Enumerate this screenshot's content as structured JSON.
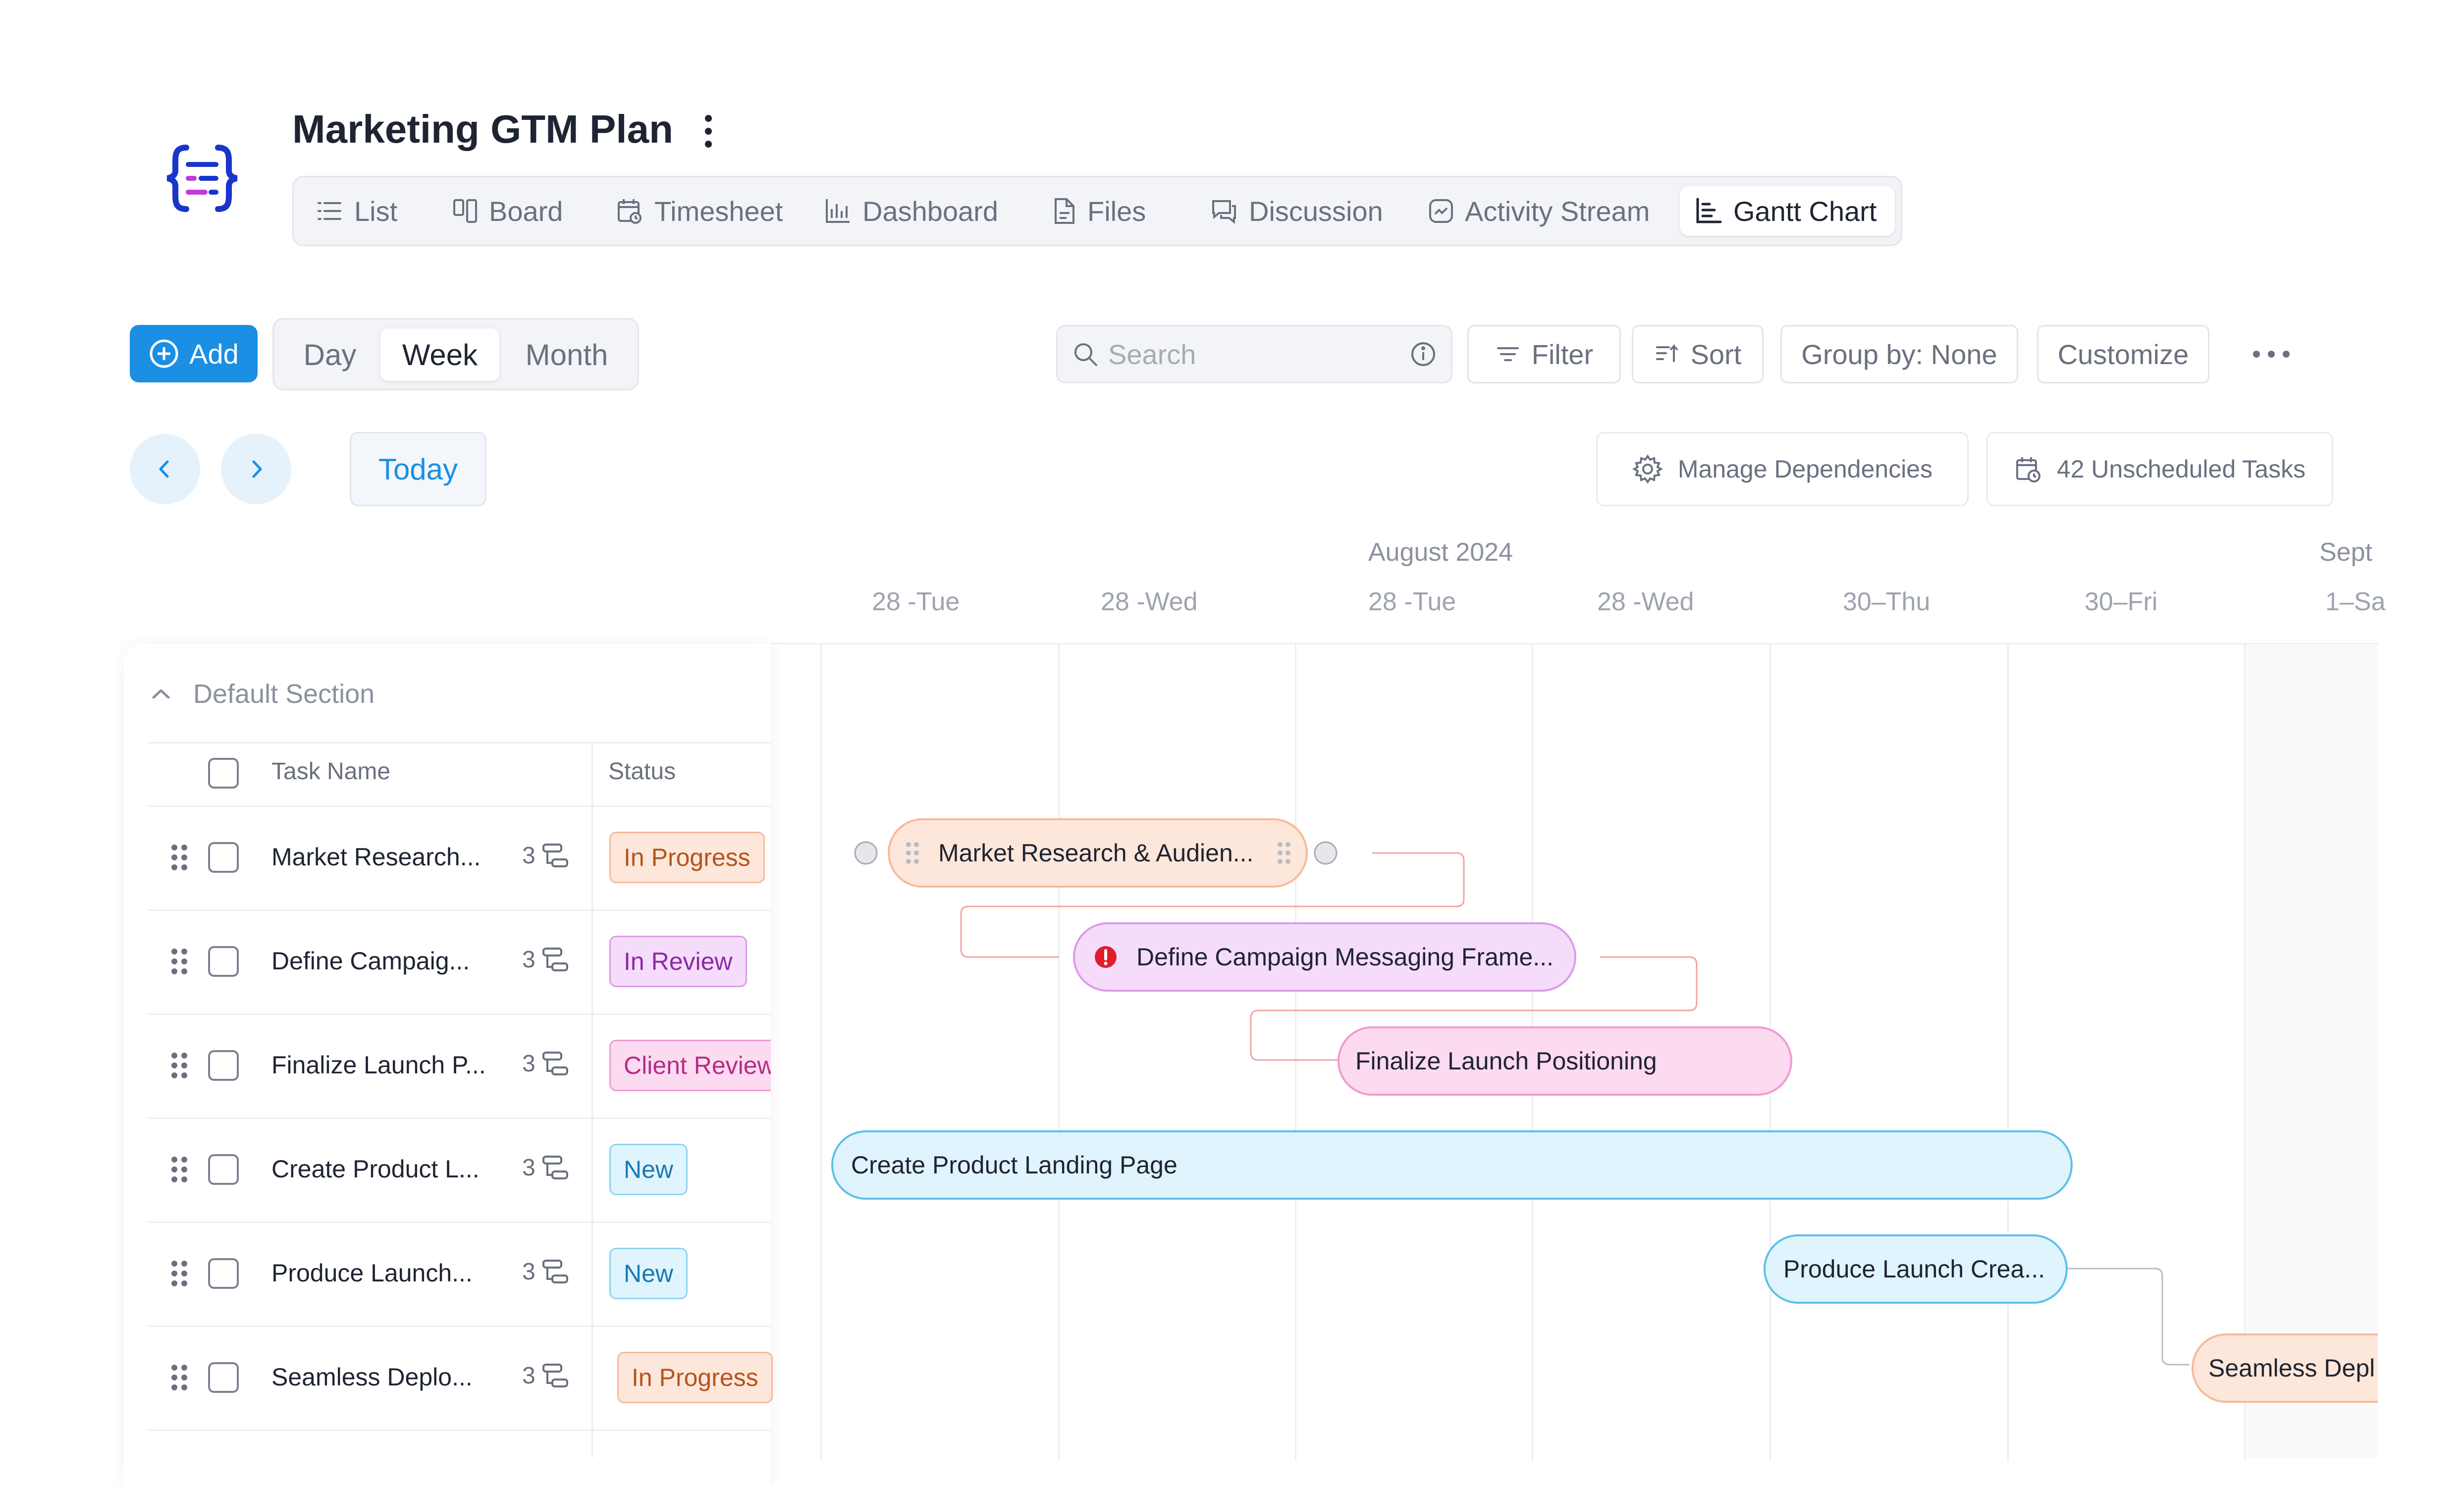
{
  "project": {
    "title": "Marketing GTM Plan"
  },
  "tabs": [
    {
      "label": "List",
      "icon": "list-icon"
    },
    {
      "label": "Board",
      "icon": "board-icon"
    },
    {
      "label": "Timesheet",
      "icon": "timesheet-icon"
    },
    {
      "label": "Dashboard",
      "icon": "dashboard-icon"
    },
    {
      "label": "Files",
      "icon": "file-icon"
    },
    {
      "label": "Discussion",
      "icon": "discussion-icon"
    },
    {
      "label": "Activity Stream",
      "icon": "activity-icon"
    },
    {
      "label": "Gantt Chart",
      "icon": "gantt-icon",
      "active": true
    }
  ],
  "toolbar": {
    "add_label": "Add",
    "views": [
      "Day",
      "Week",
      "Month"
    ],
    "active_view": "Week",
    "search_placeholder": "Search",
    "filter_label": "Filter",
    "sort_label": "Sort",
    "group_label": "Group by: None",
    "customize_label": "Customize"
  },
  "nav": {
    "today_label": "Today",
    "manage_dependencies_label": "Manage Dependencies",
    "unscheduled_label": "42 Unscheduled Tasks"
  },
  "timeline": {
    "months": [
      "August 2024",
      "Sept"
    ],
    "days": [
      "28 -Tue",
      "28 -Wed",
      "28 -Tue",
      "28 -Wed",
      "30–Thu",
      "30–Fri",
      "1–Sa"
    ]
  },
  "section": {
    "name": "Default Section"
  },
  "columns": {
    "task_name": "Task Name",
    "status": "Status"
  },
  "tasks": [
    {
      "name": "Market Research...",
      "subtasks": "3",
      "status": "In Progress",
      "bar_label": "Market Research & Audien..."
    },
    {
      "name": "Define Campaig...",
      "subtasks": "3",
      "status": "In Review",
      "bar_label": "Define Campaign Messaging Frame..."
    },
    {
      "name": "Finalize Launch P...",
      "subtasks": "3",
      "status": "Client Review",
      "bar_label": "Finalize Launch Positioning"
    },
    {
      "name": "Create Product L...",
      "subtasks": "3",
      "status": "New",
      "bar_label": "Create Product Landing Page"
    },
    {
      "name": "Produce Launch...",
      "subtasks": "3",
      "status": "New",
      "bar_label": "Produce Launch Crea..."
    },
    {
      "name": "Seamless Deplo...",
      "subtasks": "3",
      "status": "In Progress",
      "bar_label": "Seamless Depl"
    }
  ],
  "colors": {
    "accent": "#1a8fe3",
    "in_progress": "#fde7da",
    "in_review": "#f6dcfb",
    "client_review": "#fcdaf0",
    "new": "#dff4fd",
    "warning": "#e21d2a"
  }
}
